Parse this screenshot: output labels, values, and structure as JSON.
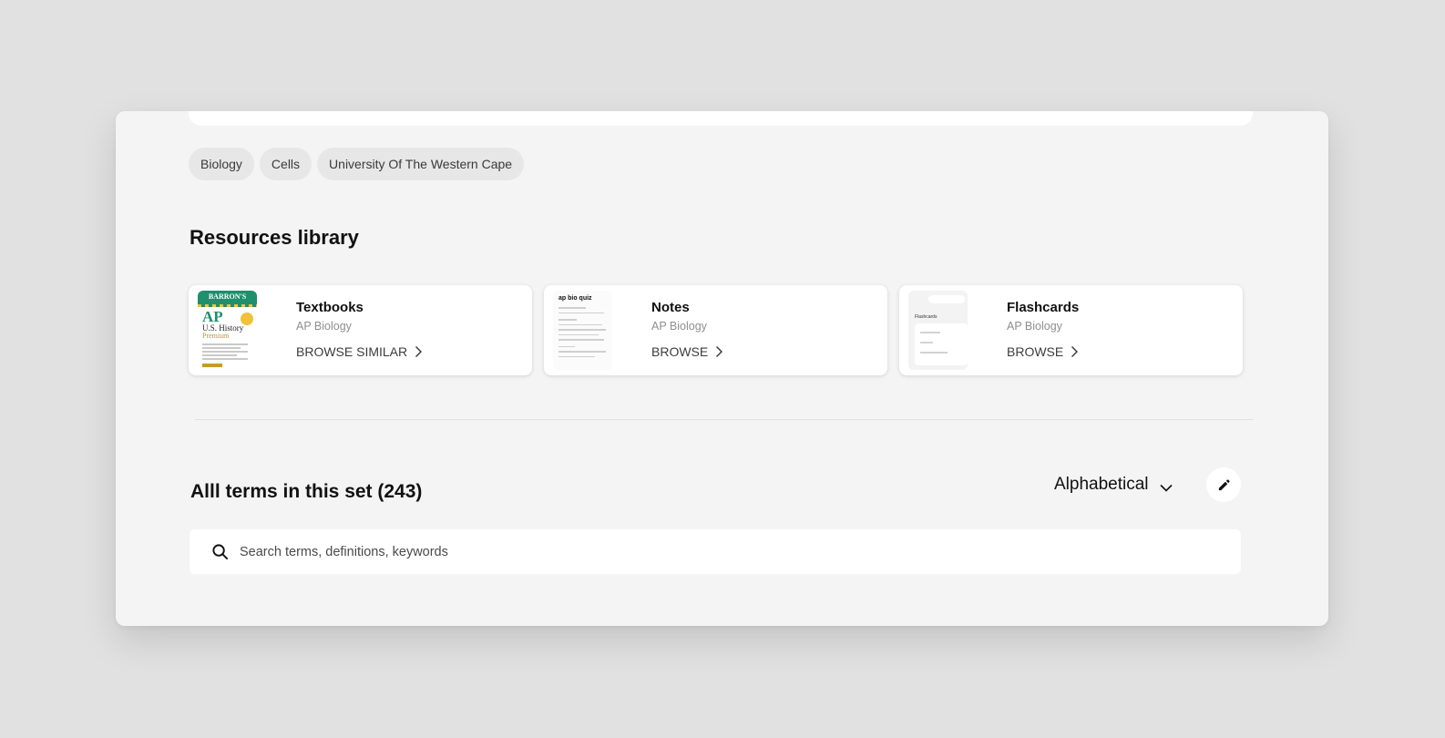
{
  "tags": [
    "Biology",
    "Cells",
    "University Of The Western Cape"
  ],
  "resources": {
    "title": "Resources library",
    "cards": [
      {
        "title": "Textbooks",
        "subtitle": "AP Biology",
        "link": "BROWSE SIMILAR",
        "thumb": "book-cover-image",
        "cover": {
          "publisher": "BARRON'S",
          "ap": "AP",
          "subject": "U.S. History",
          "edition": "Premium"
        }
      },
      {
        "title": "Notes",
        "subtitle": "AP Biology",
        "link": "BROWSE",
        "thumb": "notes-preview-image",
        "notes_heading": "ap bio quiz"
      },
      {
        "title": "Flashcards",
        "subtitle": "AP Biology",
        "link": "BROWSE",
        "thumb": "flashcards-preview-image",
        "fc_label": "Flashcards"
      }
    ]
  },
  "terms": {
    "title": "Alll terms in this set (243)",
    "sort_label": "Alphabetical",
    "search_placeholder": "Search terms, definitions, keywords"
  },
  "icons": {
    "search": "search-icon",
    "sort_chevron": "chevron-down-icon",
    "edit": "pencil-icon",
    "card_chevron": "chevron-right-icon"
  },
  "colors": {
    "page_bg": "#e1e1e1",
    "panel_bg": "#f4f4f4",
    "tag_bg": "#e7e7e7",
    "card_bg": "#ffffff",
    "book_green": "#1f8f6c",
    "book_yellow": "#f0c23b"
  }
}
